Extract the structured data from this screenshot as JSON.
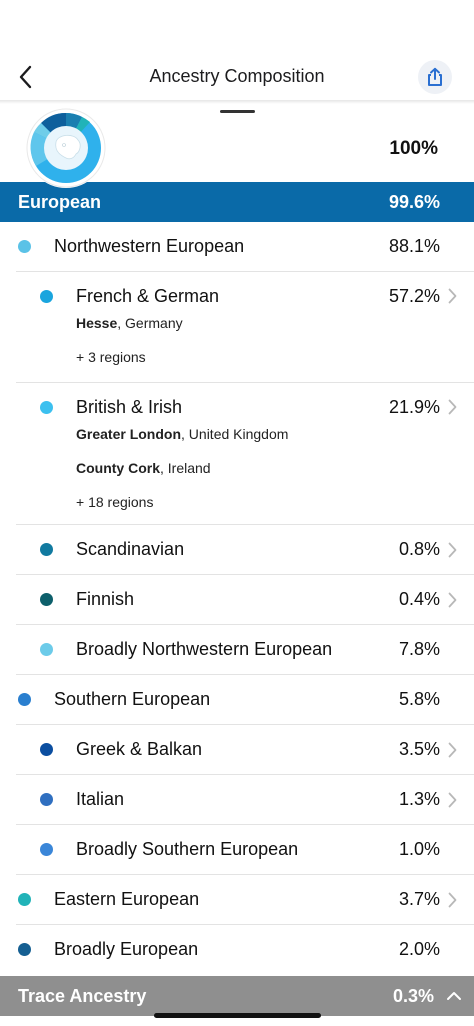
{
  "header": {
    "title": "Ancestry Composition"
  },
  "summary": {
    "total_label": "100%"
  },
  "region": {
    "label": "European",
    "percent": "99.6%"
  },
  "rows": [
    {
      "label": "Northwestern European",
      "percent": "88.1%",
      "color": "#5bc2e7",
      "level": 1
    },
    {
      "label": "French & German",
      "percent": "57.2%",
      "color": "#1aa5de",
      "level": 2,
      "details": [
        {
          "place": "Hesse",
          "country": ", Germany"
        }
      ],
      "more": "+ 3 regions"
    },
    {
      "label": "British & Irish",
      "percent": "21.9%",
      "color": "#3cc0ef",
      "level": 2,
      "details": [
        {
          "place": "Greater London",
          "country": ", United Kingdom"
        },
        {
          "place": "County Cork",
          "country": ", Ireland"
        }
      ],
      "more": "+ 18 regions"
    },
    {
      "label": "Scandinavian",
      "percent": "0.8%",
      "color": "#117aa0",
      "level": 2
    },
    {
      "label": "Finnish",
      "percent": "0.4%",
      "color": "#0d5f6b",
      "level": 2
    },
    {
      "label": "Broadly Northwestern European",
      "percent": "7.8%",
      "color": "#6ccbe9",
      "level": 2
    },
    {
      "label": "Southern European",
      "percent": "5.8%",
      "color": "#2a7fcf",
      "level": 1
    },
    {
      "label": "Greek & Balkan",
      "percent": "3.5%",
      "color": "#0b4ea0",
      "level": 2
    },
    {
      "label": "Italian",
      "percent": "1.3%",
      "color": "#2f6fc0",
      "level": 2
    },
    {
      "label": "Broadly Southern European",
      "percent": "1.0%",
      "color": "#3a86d8",
      "level": 2
    },
    {
      "label": "Eastern European",
      "percent": "3.7%",
      "color": "#21b3b8",
      "level": 1
    },
    {
      "label": "Broadly European",
      "percent": "2.0%",
      "color": "#155f92",
      "level": 1
    }
  ],
  "trace": {
    "label": "Trace Ancestry",
    "percent": "0.3%"
  },
  "icons": {
    "back": "chevron-left-icon",
    "share": "share-icon",
    "row_chevron": "chevron-right-icon",
    "trace_chevron": "chevron-up-icon"
  }
}
